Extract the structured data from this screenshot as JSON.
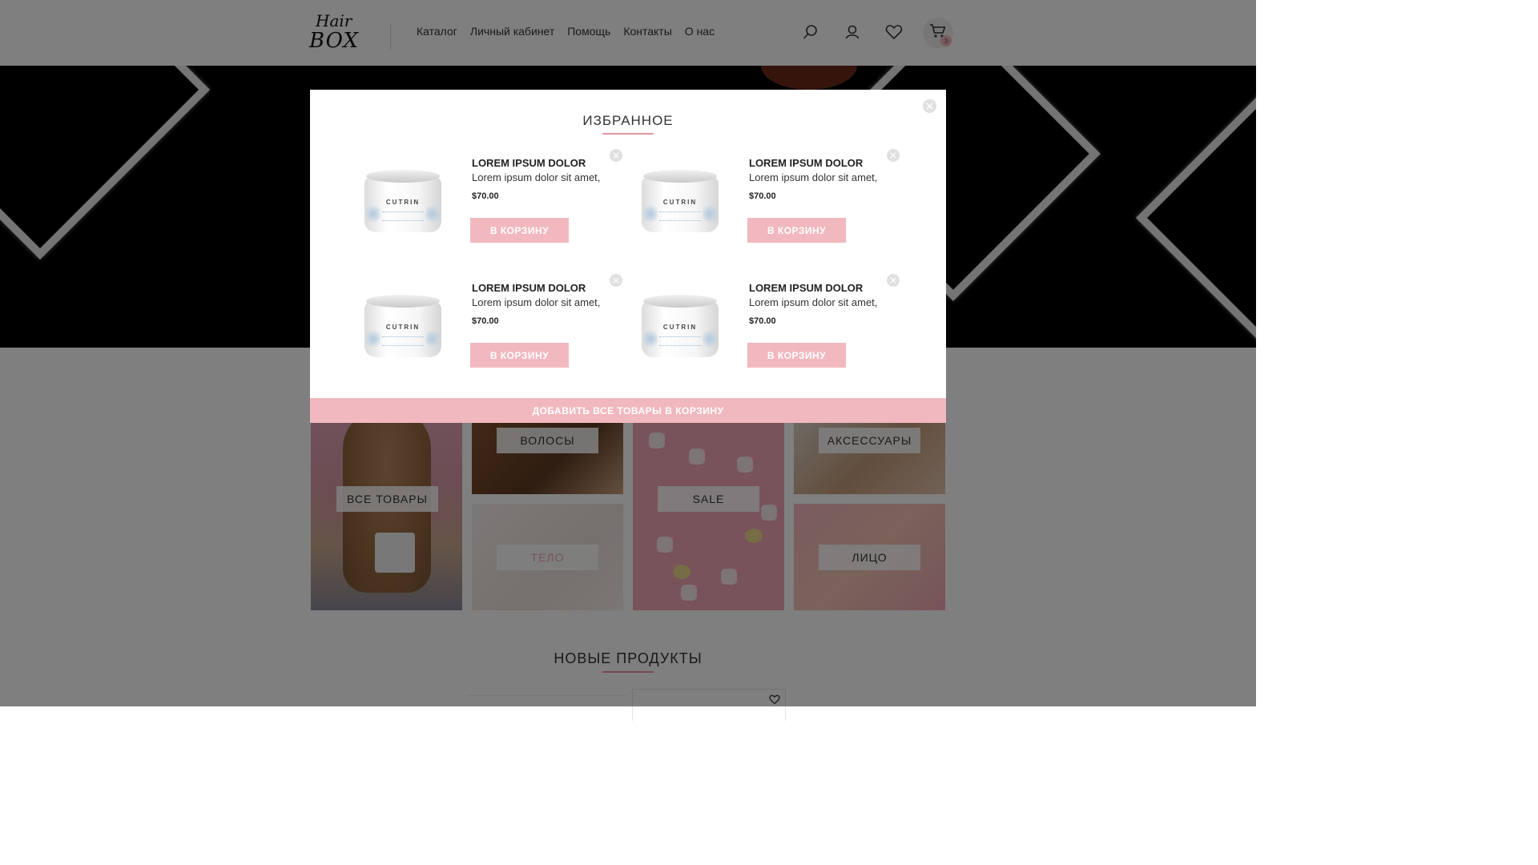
{
  "header": {
    "logo_line1": "Hair",
    "logo_line2": "BOX",
    "nav": [
      "Каталог",
      "Личный кабинет",
      "Помощь",
      "Контакты",
      "О нас"
    ],
    "icons": [
      "search-icon",
      "user-icon",
      "heart-icon",
      "cart-icon"
    ],
    "cart_count": "3"
  },
  "categories": {
    "all": "ВСЕ ТОВАРЫ",
    "hair": "ВОЛОСЫ",
    "body": "ТЕЛО",
    "sale": "SALE",
    "accessories": "АКСЕССУАРЫ",
    "face": "ЛИЦО"
  },
  "new_products": {
    "title": "НОВЫЕ ПРОДУКТЫ"
  },
  "modal": {
    "title": "ИЗБРАННОЕ",
    "items": [
      {
        "brand": "CUTRIN",
        "name": "LOREM IPSUM DOLOR",
        "desc": "Lorem ipsum dolor sit amet,",
        "price": "$70.00",
        "button": "В КОРЗИНУ"
      },
      {
        "brand": "CUTRIN",
        "name": "LOREM IPSUM DOLOR",
        "desc": "Lorem ipsum dolor sit amet,",
        "price": "$70.00",
        "button": "В КОРЗИНУ"
      },
      {
        "brand": "CUTRIN",
        "name": "LOREM IPSUM DOLOR",
        "desc": "Lorem ipsum dolor sit amet,",
        "price": "$70.00",
        "button": "В КОРЗИНУ"
      },
      {
        "brand": "CUTRIN",
        "name": "LOREM IPSUM DOLOR",
        "desc": "Lorem ipsum dolor sit amet,",
        "price": "$70.00",
        "button": "В КОРЗИНУ"
      }
    ],
    "add_all": "ДОБАВИТЬ ВСЕ ТОВАРЫ В КОРЗИНУ"
  },
  "colors": {
    "accent_pink": "#f2b8bf",
    "underline_pink": "#e2969f",
    "overlay": "rgba(0,0,0,0.5)"
  }
}
